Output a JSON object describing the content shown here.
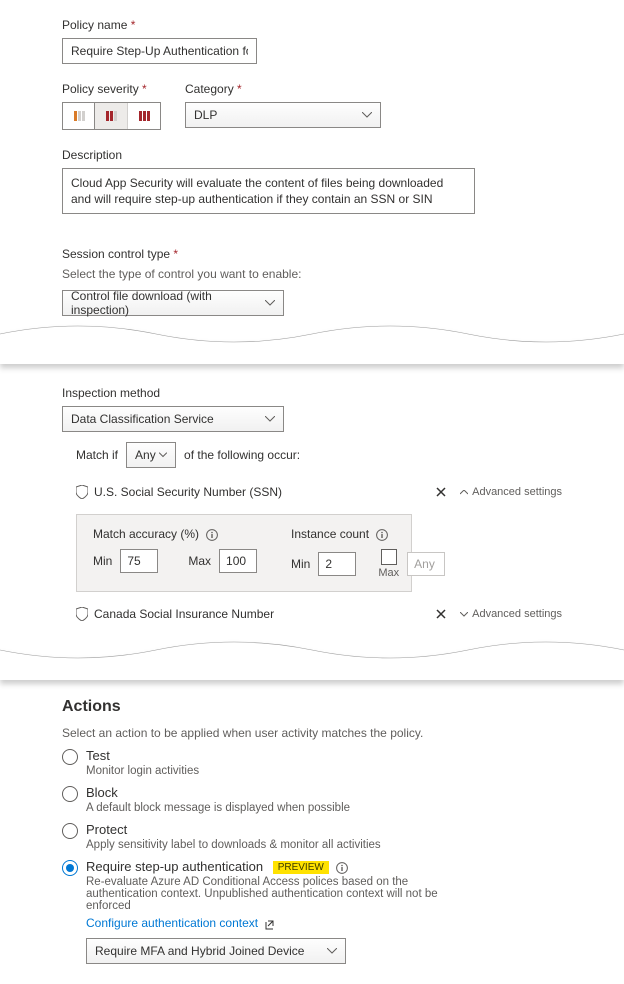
{
  "policyName": {
    "label": "Policy name",
    "value": "Require Step-Up Authentication for PII"
  },
  "severity": {
    "label": "Policy severity",
    "selectedIndex": 1
  },
  "category": {
    "label": "Category",
    "value": "DLP"
  },
  "description": {
    "label": "Description",
    "value": "Cloud App Security will evaluate the content of files being downloaded and will require step-up authentication if they contain an SSN or SIN"
  },
  "sessionControl": {
    "label": "Session control type",
    "helper": "Select the type of control you want to enable:",
    "value": "Control file download (with inspection)"
  },
  "inspection": {
    "label": "Inspection method",
    "value": "Data Classification Service",
    "match": {
      "prefix": "Match if",
      "mode": "Any",
      "suffix": "of the following occur:"
    },
    "advanced": "Advanced settings",
    "classifiers": [
      {
        "name": "U.S. Social Security Number (SSN)",
        "expanded": true
      },
      {
        "name": "Canada Social Insurance Number",
        "expanded": false
      }
    ],
    "accuracy": {
      "label": "Match accuracy (%)",
      "minLabel": "Min",
      "minValue": "75",
      "maxLabel": "Max",
      "maxValue": "100"
    },
    "instance": {
      "label": "Instance count",
      "minLabel": "Min",
      "minValue": "2",
      "maxLabel": "Max",
      "maxChecked": false,
      "maxValue": "Any"
    }
  },
  "actions": {
    "heading": "Actions",
    "helper": "Select an action to be applied when user activity matches the policy.",
    "options": [
      {
        "title": "Test",
        "desc": "Monitor login activities",
        "selected": false
      },
      {
        "title": "Block",
        "desc": "A default block message is displayed when possible",
        "selected": false
      },
      {
        "title": "Protect",
        "desc": "Apply sensitivity label to downloads & monitor all activities",
        "selected": false
      },
      {
        "title": "Require step-up authentication",
        "desc": "Re-evaluate Azure AD Conditional Access polices based on the authentication context. Unpublished authentication context will not be enforced",
        "selected": true,
        "preview": "PREVIEW",
        "link": "Configure authentication context",
        "selectValue": "Require MFA and Hybrid Joined Device"
      }
    ]
  }
}
